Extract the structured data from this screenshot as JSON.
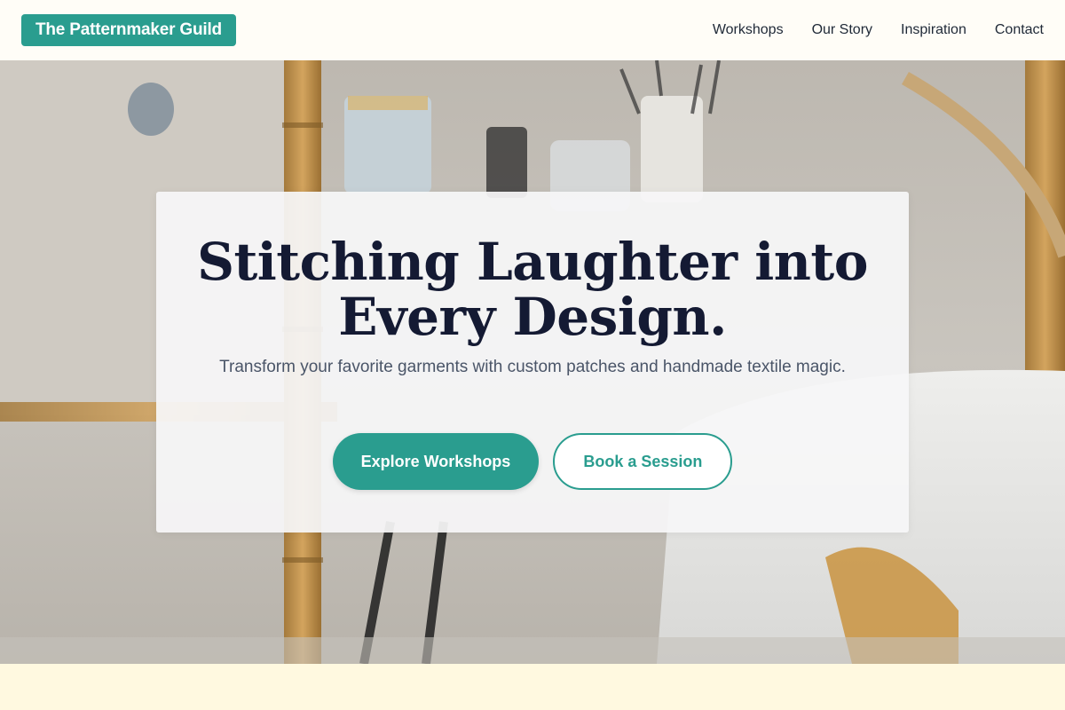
{
  "header": {
    "brand": "The Patternmaker Guild",
    "nav": [
      {
        "label": "Workshops"
      },
      {
        "label": "Our Story"
      },
      {
        "label": "Inspiration"
      },
      {
        "label": "Contact"
      }
    ]
  },
  "hero": {
    "title": "Stitching Laughter into Every Design.",
    "subtitle": "Transform your favorite garments with custom patches and handmade textile magic.",
    "primary_cta": "Explore Workshops",
    "secondary_cta": "Book a Session"
  },
  "colors": {
    "accent": "#2a9d8f",
    "title": "#141a33",
    "header_bg": "#fffdf7",
    "section_bg": "#fff9e0"
  }
}
